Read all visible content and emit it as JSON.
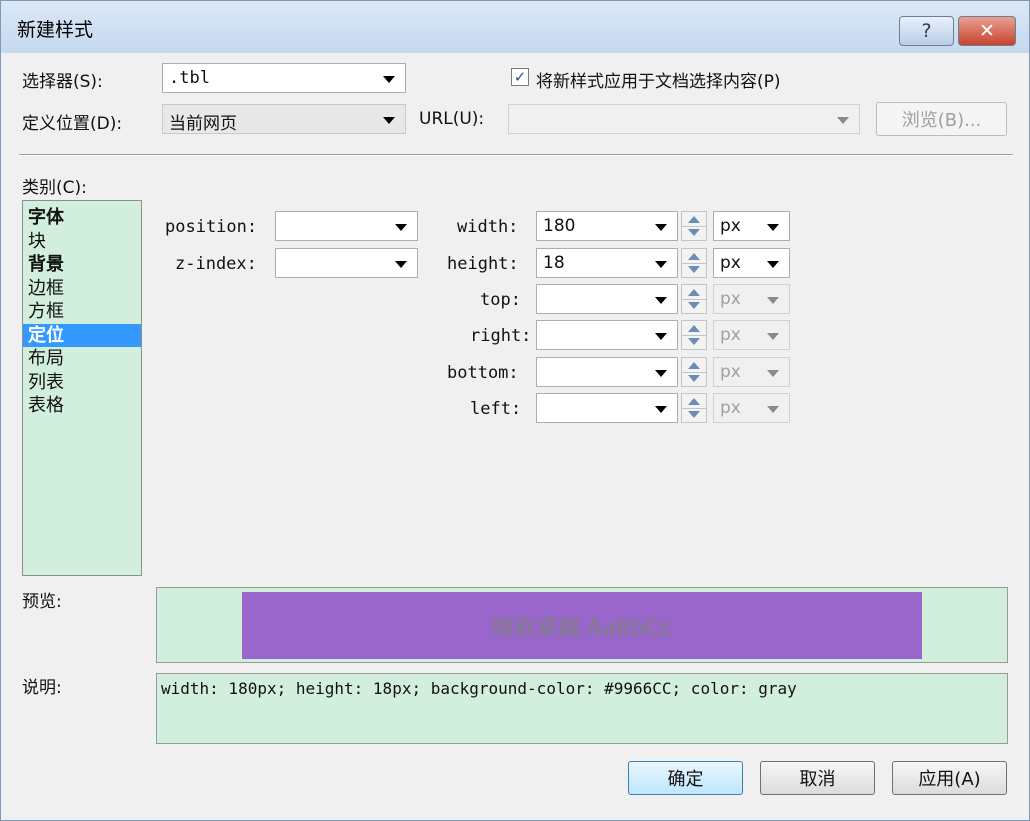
{
  "window": {
    "title": "新建样式",
    "help_label": "?",
    "close_label": "✕"
  },
  "selector": {
    "label": "选择器(S):",
    "value": ".tbl"
  },
  "apply_checkbox": {
    "checked_mark": "✓",
    "label": "将新样式应用于文档选择内容(P)"
  },
  "define_in": {
    "label": "定义位置(D):",
    "value": "当前网页"
  },
  "url": {
    "label": "URL(U):",
    "value": ""
  },
  "browse_label": "浏览(B)...",
  "category": {
    "label": "类别(C):",
    "items": [
      {
        "label": "字体",
        "bold": true
      },
      {
        "label": "块",
        "bold": false
      },
      {
        "label": "背景",
        "bold": true
      },
      {
        "label": "边框",
        "bold": false
      },
      {
        "label": "方框",
        "bold": false
      },
      {
        "label": "定位",
        "bold": true,
        "selected": true
      },
      {
        "label": "布局",
        "bold": false
      },
      {
        "label": "列表",
        "bold": false
      },
      {
        "label": "表格",
        "bold": false
      }
    ]
  },
  "positioning": {
    "position": {
      "label": "position:",
      "value": ""
    },
    "z_index": {
      "label": "z-index:",
      "value": ""
    },
    "width": {
      "label": "width:",
      "value": "180",
      "unit": "px"
    },
    "height": {
      "label": "height:",
      "value": "18",
      "unit": "px"
    },
    "top": {
      "label": "top:",
      "value": "",
      "unit": "px"
    },
    "right": {
      "label": "right:",
      "value": "",
      "unit": "px"
    },
    "bottom": {
      "label": "bottom:",
      "value": "",
      "unit": "px"
    },
    "left": {
      "label": "left:",
      "value": "",
      "unit": "px"
    }
  },
  "preview": {
    "label": "预览:",
    "sample_text": "微软卓越 AaBbCc"
  },
  "description": {
    "label": "说明:",
    "text": "width: 180px; height: 18px; background-color: #9966CC; color: gray"
  },
  "buttons": {
    "ok": "确定",
    "cancel": "取消",
    "apply": "应用(A)"
  },
  "colors": {
    "sample_background": "#9966cc",
    "sample_text": "#808080",
    "list_background": "#d2efdd",
    "selection": "#3399ff"
  }
}
